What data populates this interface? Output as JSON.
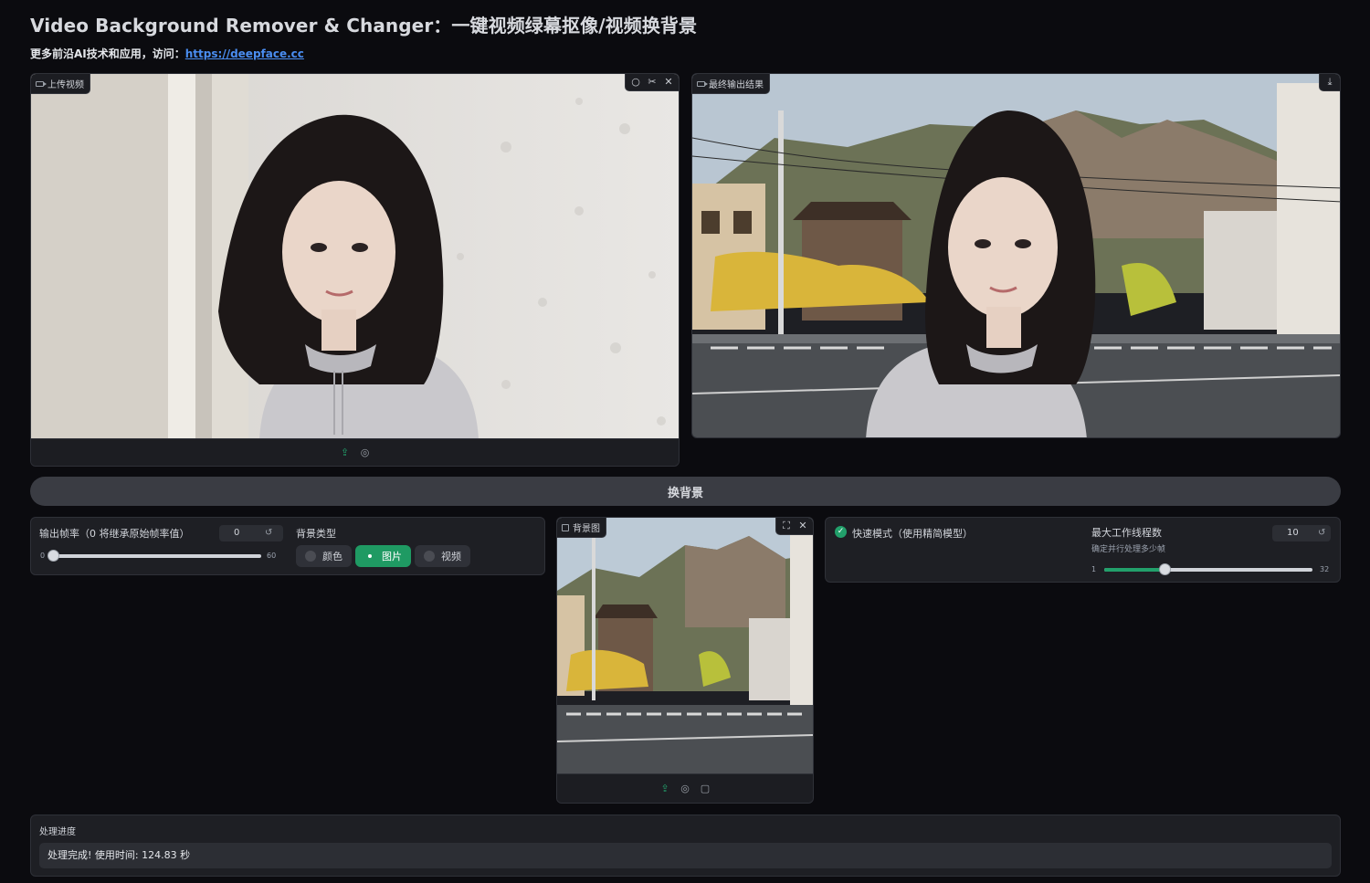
{
  "header": {
    "title": "Video Background Remover & Changer：一键视频绿幕抠像/视频换背景",
    "subtitle_prefix": "更多前沿AI技术和应用，访问：",
    "subtitle_link": "https://deepface.cc"
  },
  "upload_panel": {
    "label": "上传视频",
    "icon": "video-camera-icon",
    "corner_tools": [
      "rotate-icon",
      "scissors-icon",
      "close-icon"
    ],
    "bottom_tools": [
      "upload-icon",
      "webcam-icon"
    ]
  },
  "output_panel": {
    "label": "最终输出结果",
    "icon": "video-camera-icon",
    "corner_tools": [
      "download-icon"
    ]
  },
  "action": {
    "swap_label": "换背景"
  },
  "fps": {
    "label": "输出帧率（0 将继承原始帧率值）",
    "value": "0",
    "min": "0",
    "max": "60",
    "current": 0
  },
  "bg_type": {
    "label": "背景类型",
    "options": [
      "颜色",
      "图片",
      "视频"
    ],
    "selected": "图片"
  },
  "bg_image_panel": {
    "label": "背景图",
    "icon": "image-icon",
    "corner_tools": [
      "fullscreen-icon",
      "close-icon"
    ],
    "bottom_tools": [
      "upload-icon",
      "webcam-icon",
      "clipboard-icon"
    ]
  },
  "fast_mode": {
    "label": "快速模式（使用精简模型）",
    "checked": true
  },
  "threads": {
    "label": "最大工作线程数",
    "help": "确定并行处理多少帧",
    "value": "10",
    "min": "1",
    "max": "32",
    "current": 10
  },
  "progress": {
    "label": "处理进度",
    "status": "处理完成! 使用时间: 124.83 秒"
  },
  "colors": {
    "accent": "#22a06b",
    "background": "#0b0b0f",
    "panel": "#1e1f24"
  }
}
